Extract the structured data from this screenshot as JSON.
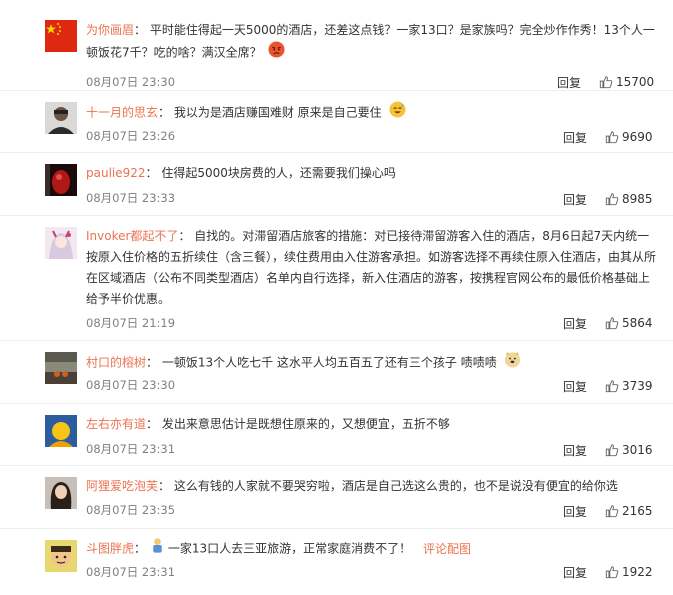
{
  "comments": [
    {
      "user": "为你画眉",
      "text": "平时能住得起一天5000的酒店，还差这点钱？一家13口？是家族吗？完全炒作作秀！13个人一顿饭花7千？吃的啥？满汉全席？",
      "time": "08月07日 23:30",
      "reply": "回复",
      "likes": "15700",
      "avatar_icon": "china-flag-avatar",
      "emoji": "angry-face-emoji"
    },
    {
      "user": "十一月的思玄",
      "text": "我以为是酒店赚国难财 原来是自己要住",
      "time": "08月07日 23:26",
      "reply": "回复",
      "likes": "9690",
      "avatar_icon": "man-photo-avatar",
      "emoji": "sweat-smile-emoji"
    },
    {
      "user": "paulie922",
      "text": "住得起5000块房费的人，还需要我们操心吗",
      "time": "08月07日 23:33",
      "reply": "回复",
      "likes": "8985",
      "avatar_icon": "red-photo-avatar"
    },
    {
      "user": "Invoker都起不了",
      "text": "自找的。对滞留酒店旅客的措施：对已接待滞留游客入住的酒店，8月6日起7天内统一按原入住价格的五折续住（含三餐），续住费用由入住游客承担。如游客选择不再续住原入住酒店，由其从所在区域酒店（公布不同类型酒店）名单内自行选择，新入住酒店的游客，按携程官网公布的最低价格基础上给予半价优惠。",
      "time": "08月07日 21:19",
      "reply": "回复",
      "likes": "5864",
      "avatar_icon": "anime-girl-avatar"
    },
    {
      "user": "村口的榕树",
      "text": "一顿饭13个人吃七千 这水平人均五百五了还有三个孩子 啧啧啧",
      "time": "08月07日 23:30",
      "reply": "回复",
      "likes": "3739",
      "avatar_icon": "street-photo-avatar",
      "emoji": "doge-emoji"
    },
    {
      "user": "左右亦有道",
      "text": "发出来意思估计是既想住原来的，又想便宜，五折不够",
      "time": "08月07日 23:31",
      "reply": "回复",
      "likes": "3016",
      "avatar_icon": "blue-yellow-avatar"
    },
    {
      "user": "阿狸爱吃泡芙",
      "text": "这么有钱的人家就不要哭穷啦，酒店是自己选这么贵的，也不是说没有便宜的给你选",
      "time": "08月07日 23:35",
      "reply": "回复",
      "likes": "2165",
      "avatar_icon": "woman-photo-avatar"
    },
    {
      "user": "斗图胖虎",
      "text": "一家13口人去三亚旅游，正常家庭消费不了！",
      "time": "08月07日 23:31",
      "reply": "回复",
      "likes": "1922",
      "avatar_icon": "cartoon-avatar",
      "pic_link": "评论配图",
      "emoji": "person-emoji"
    }
  ],
  "colors": {
    "username": "#eb7350",
    "meta": "#808080",
    "divider": "#eeeeee"
  }
}
